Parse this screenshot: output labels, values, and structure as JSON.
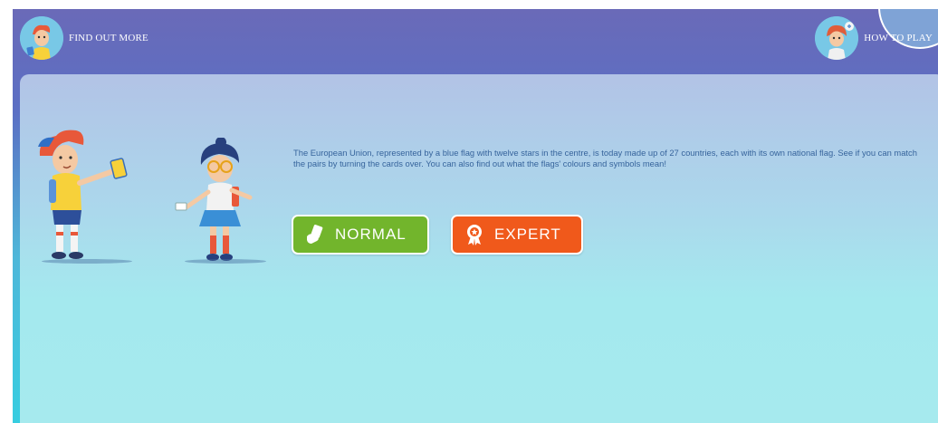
{
  "header": {
    "find_out_more_label": "FIND OUT MORE",
    "how_to_play_label": "HOW TO PLAY"
  },
  "intro": {
    "description": "The European Union, represented by a blue flag with twelve stars in the centre, is today made up of 27 countries, each with its own national flag. See if you can match the pairs by turning the cards over. You can also find out what the flags' colours and symbols mean!"
  },
  "modes": {
    "normal_label": "NORMAL",
    "expert_label": "EXPERT"
  },
  "colors": {
    "header_bg": "#6a6ab8",
    "panel_bg": "#a6eaee",
    "text": "#36649c",
    "normal_button": "#72b52c",
    "expert_button": "#f0591b"
  },
  "icons": {
    "normal": "hand-card-icon",
    "expert": "award-ribbon-icon"
  }
}
